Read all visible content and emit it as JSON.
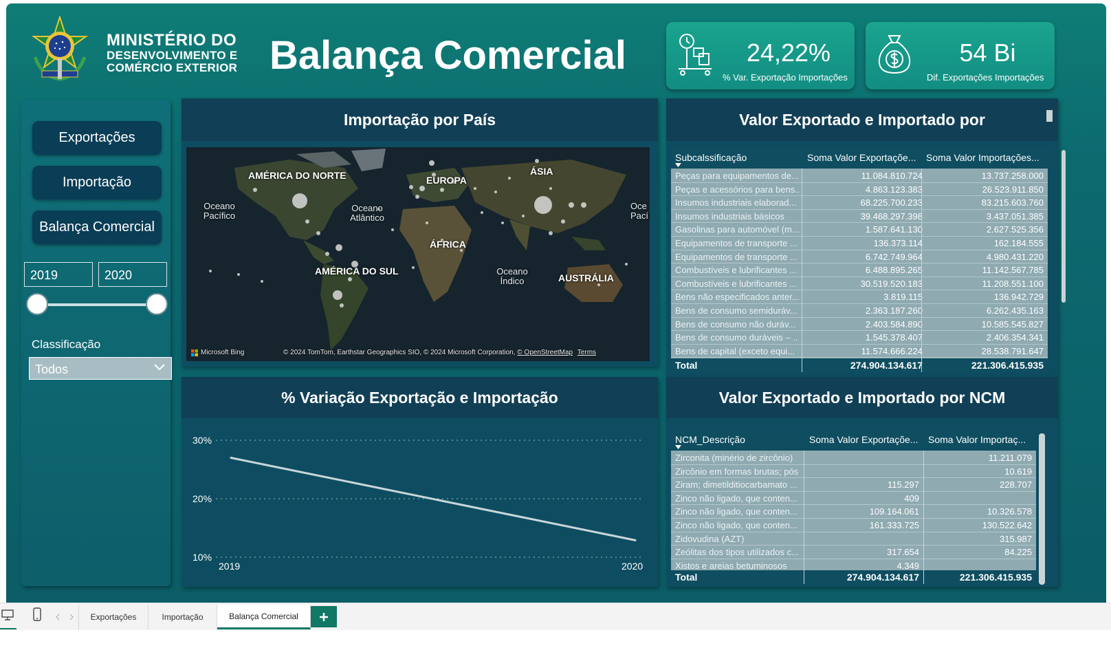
{
  "header": {
    "ministry_line1": "MINISTÉRIO DO",
    "ministry_line2": "DESENVOLVIMENTO E",
    "ministry_line3": "COMÉRCIO EXTERIOR",
    "title": "Balança Comercial"
  },
  "kpis": [
    {
      "value": "24,22%",
      "label": "% Var. Exportação Importações",
      "icon": "trade-scale-icon"
    },
    {
      "value": "54 Bi",
      "label": "Dif. Exportações Importações",
      "icon": "money-bag-icon"
    }
  ],
  "sidebar": {
    "buttons": [
      "Exportações",
      "Importação",
      "Balança Comercial"
    ],
    "year_from": "2019",
    "year_to": "2020",
    "slider_range": [
      2019,
      2020
    ],
    "classificacao_label": "Classificação",
    "classificacao_value": "Todos"
  },
  "map_panel": {
    "title": "Importação por País",
    "continents": [
      "AMÉRICA DO NORTE",
      "EUROPA",
      "ÁSIA",
      "ÁFRICA",
      "AMÉRICA DO SUL",
      "AUSTRÁLIA"
    ],
    "oceans": [
      "Oceano Pacífico",
      "Oceano Atlântico",
      "Oceano Índico",
      "Oce Pací"
    ],
    "bing_label": "Microsoft Bing",
    "attribution": "© 2024 TomTom, Earthstar Geographics SIO, © 2024 Microsoft Corporation,",
    "osm_link": "© OpenStreetMap",
    "terms_link": "Terms"
  },
  "table1": {
    "title": "Valor Exportado e Importado por",
    "headers": [
      "Subcalssificação",
      "Soma Valor Exportaçõe...",
      "Soma Valor Importações..."
    ],
    "rows": [
      [
        "Peças para equipamentos de...",
        "11.084.810.724",
        "13.737.258.000"
      ],
      [
        "Peças e acessórios para bens...",
        "4.863.123.383",
        "26.523.911.850"
      ],
      [
        "Insumos industriais elaborad...",
        "68.225.700.233",
        "83.215.603.760"
      ],
      [
        "Insumos industriais básicos",
        "39.468.297.398",
        "3.437.051.385"
      ],
      [
        "Gasolinas para automóvel (m...",
        "1.587.641.130",
        "2.627.525.356"
      ],
      [
        "Equipamentos de transporte ...",
        "136.373.114",
        "162.184.555"
      ],
      [
        "Equipamentos de transporte ...",
        "6.742.749.964",
        "4.980.431.220"
      ],
      [
        "Combustíveis e lubrificantes ...",
        "6.488.895.265",
        "11.142.567.785"
      ],
      [
        "Combustíveis e lubrificantes ...",
        "30.519.520.183",
        "11.208.551.100"
      ],
      [
        "Bens não especificados anter...",
        "3.819.115",
        "136.942.729"
      ],
      [
        "Bens de consumo semiduráv...",
        "2.363.187.260",
        "6.262.435.163"
      ],
      [
        "Bens de consumo não duráv...",
        "2.403.584.890",
        "10.585.545.827"
      ],
      [
        "Bens de consumo duráveis – ...",
        "1.545.378.407",
        "2.406.354.341"
      ],
      [
        "Bens de capital (exceto equi...",
        "11.574.666.224",
        "28.538.791.647"
      ]
    ],
    "total": [
      "Total",
      "274.904.134.617",
      "221.306.415.935"
    ]
  },
  "chart_panel": {
    "title": "% Variação Exportação e Importação"
  },
  "chart_data": {
    "type": "line",
    "title": "% Variação Exportação e Importação",
    "x": [
      "2019",
      "2020"
    ],
    "series": [
      {
        "values": [
          27.0,
          12.9
        ]
      }
    ],
    "yticks": [
      "30%",
      "20%",
      "10%"
    ],
    "ylim": [
      10,
      30
    ],
    "grid": true
  },
  "table2": {
    "title": "Valor Exportado e Importado por NCM",
    "headers": [
      "NCM_Descrição",
      "Soma Valor Exportaçõe...",
      "Soma Valor Importaç..."
    ],
    "rows": [
      [
        "Zirconita (minério de zircônio)",
        "",
        "11.211.079"
      ],
      [
        "Zircônio em formas brutas; pós",
        "",
        "10.619"
      ],
      [
        "Ziram; dimetilditiocarbamato ...",
        "115.297",
        "228.707"
      ],
      [
        "Zinco não ligado, que conten...",
        "409",
        ""
      ],
      [
        "Zinco não ligado, que conten...",
        "109.164.061",
        "10.326.578"
      ],
      [
        "Zinco não ligado, que conten...",
        "161.333.725",
        "130.522.642"
      ],
      [
        "Zidovudina (AZT)",
        "",
        "315.987"
      ],
      [
        "Zeólitas dos tipos utilizados c...",
        "317.654",
        "84.225"
      ],
      [
        "Xistos e areias betuminosos",
        "4.349",
        ""
      ]
    ],
    "total": [
      "Total",
      "274.904.134.617",
      "221.306.415.935"
    ]
  },
  "tabs": [
    "Exportações",
    "Importação",
    "Balança Comercial"
  ],
  "colors": {
    "background": "#0c6a6f",
    "panel": "#0e4d61",
    "panel_header": "#113f56",
    "kpi": "#1aa48e",
    "nav_button": "#0a3d56",
    "table_body": "#8faab1",
    "active_tab_underline": "#117865"
  }
}
